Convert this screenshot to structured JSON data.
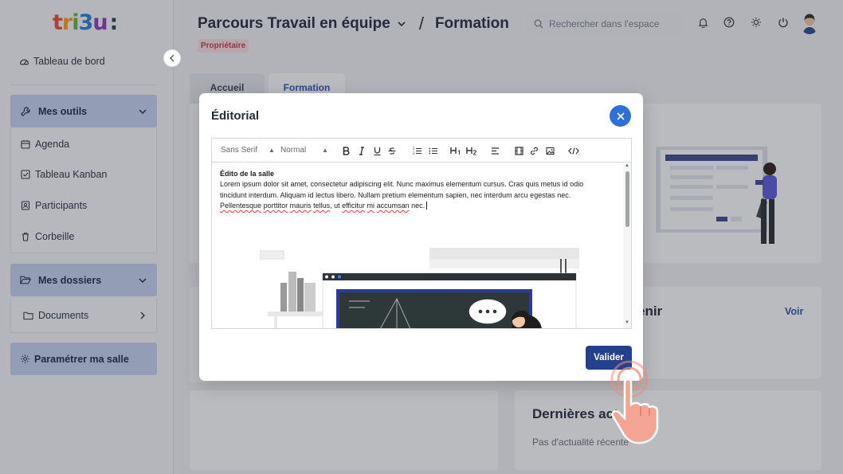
{
  "logo": {
    "parts": [
      "t",
      "r",
      "i",
      "3",
      "u",
      ":"
    ]
  },
  "sidebar": {
    "dashboard_label": "Tableau de bord",
    "tools_label": "Mes outils",
    "tools_items": [
      {
        "label": "Agenda",
        "icon": "calendar-icon"
      },
      {
        "label": "Tableau Kanban",
        "icon": "checkbox-icon"
      },
      {
        "label": "Participants",
        "icon": "contacts-icon"
      },
      {
        "label": "Corbeille",
        "icon": "trash-icon"
      }
    ],
    "folders_label": "Mes dossiers",
    "documents_label": "Documents",
    "settings_label": "Paramétrer ma salle"
  },
  "header": {
    "space_name": "Parcours Travail en équipe",
    "separator": "/",
    "page_name": "Formation",
    "role_badge": "Propriétaire",
    "search_placeholder": "Rechercher dans l'espace"
  },
  "tabs": [
    {
      "label": "Accueil"
    },
    {
      "label": "Formation"
    }
  ],
  "main": {
    "upcoming_title_partial": "enir",
    "see_link": "Voir",
    "news_title_partial": "Dernières act",
    "news_empty": "Pas d'actualité récente"
  },
  "modal": {
    "title": "Éditorial",
    "font_select": "Sans Serif",
    "size_select": "Normal",
    "content_title": "Édito de la salle",
    "content_body_1": "Lorem ipsum dolor sit amet, consectetur adipiscing elit. Nunc maximus elementum cursus. Cras quis metus id odio tincidunt interdum. Aliquam id lectus libero. Nullam pretium elementum sapien, nec interdum arcu egestas nec.",
    "content_body_2a": "Pellentesque",
    "content_body_2b": "porttitor",
    "content_body_2c": "mauris",
    "content_body_2d": "tellus",
    "content_body_2e": ", ut",
    "content_body_2f": "efficitur",
    "content_body_2g": "mi",
    "content_body_2h": "accumsan",
    "content_body_2i": "nec.",
    "validate_label": "Valider"
  },
  "colors": {
    "accent": "#2f6fd8",
    "primary_button": "#23418f",
    "sidebar_section": "#c8d3f2",
    "badge_bg": "#f9dfe1",
    "badge_text": "#c63b4c",
    "hand": "#f08b78"
  }
}
